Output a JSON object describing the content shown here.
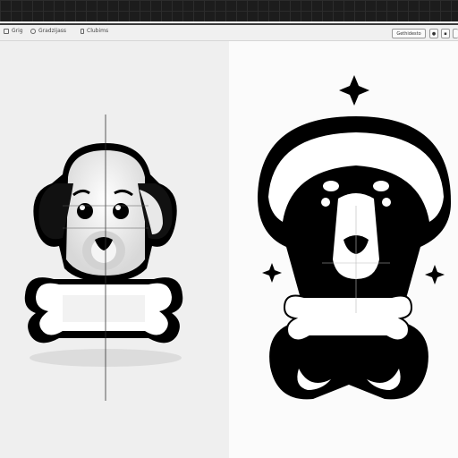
{
  "toolbar": {
    "item1_label": "Grig",
    "item2_label": "Gradzijass",
    "item3_label": "Clubims",
    "action_button_label": "Gethidesto",
    "icons": [
      "grid-icon",
      "layers-icon",
      "page-icon",
      "eye-icon",
      "settings-icon",
      "close-icon"
    ]
  },
  "colors": {
    "ink": "#000000",
    "paper": "#ffffff",
    "toolbar_bg": "#f0f0f0",
    "topbar_bg": "#1c1c1c"
  }
}
